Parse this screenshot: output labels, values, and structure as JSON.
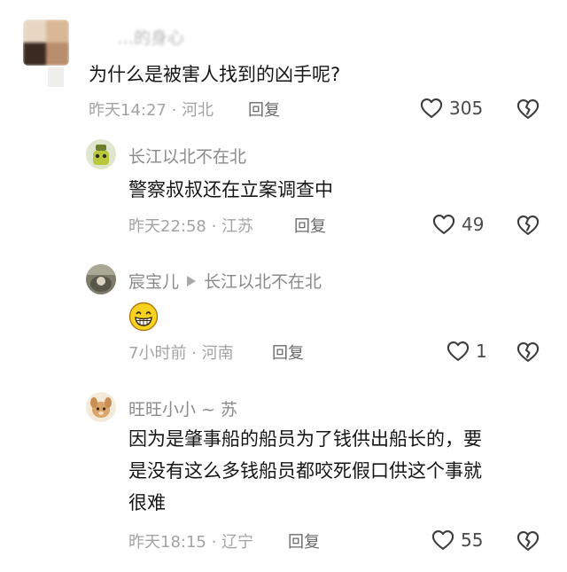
{
  "comments": [
    {
      "username": "…的身心",
      "text": "为什么是被害人找到的凶手呢?",
      "time": "昨天14:27",
      "location": "河北",
      "reply_label": "回复",
      "likes": "305"
    },
    {
      "username": "长江以北不在北",
      "text": "警察叔叔还在立案调查中",
      "time": "昨天22:58",
      "location": "江苏",
      "reply_label": "回复",
      "likes": "49"
    },
    {
      "username": "宸宝儿",
      "reply_to": "长江以北不在北",
      "text": "😁",
      "time": "7小时前",
      "location": "河南",
      "reply_label": "回复",
      "likes": "1"
    },
    {
      "username": "旺旺小小 ~ 苏",
      "text_lines": [
        "因为是肇事船的船员为了钱供出船长的，要",
        "是没有这么多钱船员都咬死假口供这个事就",
        "很难"
      ],
      "time": "昨天18:15",
      "location": "辽宁",
      "reply_label": "回复",
      "likes": "55"
    }
  ],
  "separator": " · ",
  "icons": {
    "like": "heart-outline-icon",
    "dislike": "broken-heart-icon",
    "reply_arrow": "triangle-right-icon"
  },
  "colors": {
    "name": "#8a8a8a",
    "content": "#161616",
    "meta": "#a3a3a3",
    "reply": "#6a6a6a"
  }
}
